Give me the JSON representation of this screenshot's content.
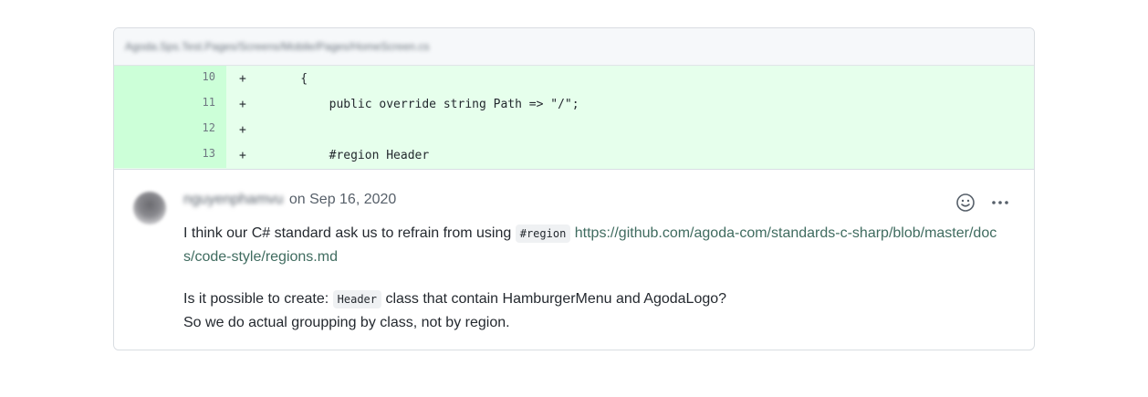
{
  "file": {
    "path": "Agoda.Sps.Test.Pages/Screens/Mobile/Pages/HomeScreen.cs"
  },
  "diff": {
    "lines": [
      {
        "number": "10",
        "sign": "+",
        "code": "    {"
      },
      {
        "number": "11",
        "sign": "+",
        "code": "        public override string Path => \"/\";"
      },
      {
        "number": "12",
        "sign": "+",
        "code": ""
      },
      {
        "number": "13",
        "sign": "+",
        "code": "        #region Header"
      }
    ]
  },
  "comment": {
    "author": "nguyenphamvu",
    "timestamp": "on Sep 16, 2020",
    "body": {
      "p1_text": "I think our C# standard ask us to refrain from using ",
      "p1_code": "#region",
      "p1_link": "https://github.com/agoda-com/standards-c-sharp/blob/master/docs/code-style/regions.md",
      "p2_line1_pre": "Is it possible to create: ",
      "p2_code": "Header",
      "p2_line1_post": " class that contain HamburgerMenu and AgodaLogo?",
      "p2_line2": "So we do actual groupping by class, not by region."
    },
    "icons": {
      "reaction": "smiley-icon",
      "more": "kebab-horizontal-icon"
    }
  },
  "colors": {
    "diff_added_bg": "#e6ffec",
    "diff_gutter_bg": "#ccffd8",
    "link": "#3f6b5f",
    "text": "#24292f",
    "muted": "#57606a"
  }
}
